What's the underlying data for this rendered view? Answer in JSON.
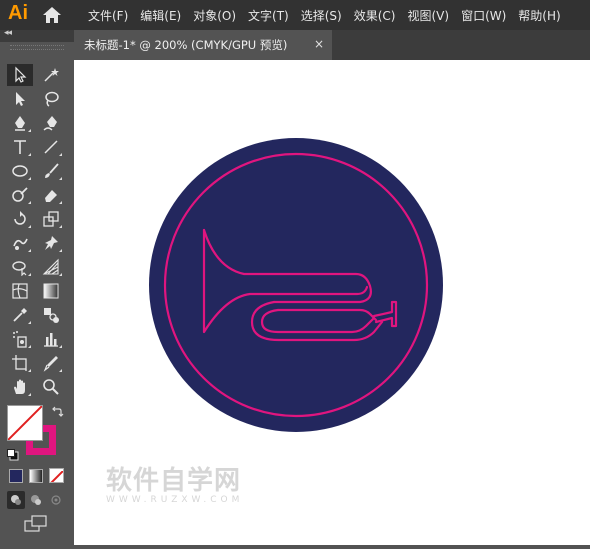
{
  "app": {
    "logo": "Ai"
  },
  "menu": [
    "文件(F)",
    "编辑(E)",
    "对象(O)",
    "文字(T)",
    "选择(S)",
    "效果(C)",
    "视图(V)",
    "窗口(W)",
    "帮助(H)"
  ],
  "document_tab": {
    "title": "未标题-1* @ 200% (CMYK/GPU 预览)",
    "close_glyph": "×"
  },
  "toolbar": {
    "collapse_glyph": "◂◂"
  },
  "colors": {
    "circle_fill": "#23275e",
    "stroke_accent": "#e0157f",
    "stroke_swatch": "#e0157f",
    "fill_swatch": "#ffffff"
  },
  "watermark": {
    "title": "软件自学网",
    "url": "WWW.RUZXW.COM"
  }
}
